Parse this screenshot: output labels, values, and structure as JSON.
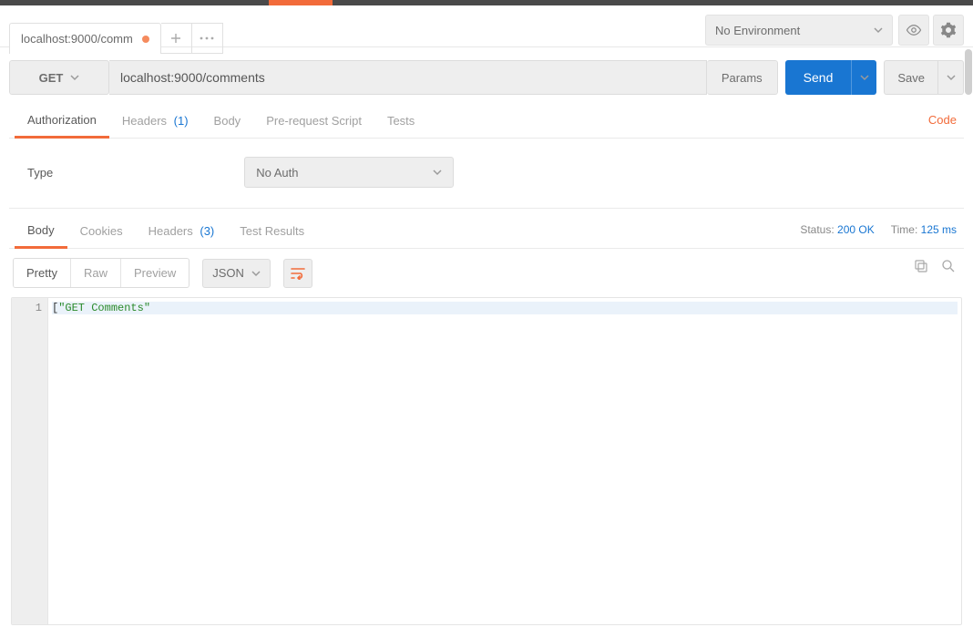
{
  "env": {
    "label": "No Environment"
  },
  "tab": {
    "title": "localhost:9000/comm",
    "unsaved": true
  },
  "request": {
    "method": "GET",
    "url": "localhost:9000/comments",
    "params_label": "Params",
    "send_label": "Send",
    "save_label": "Save"
  },
  "req_tabs": {
    "authorization": "Authorization",
    "headers_label": "Headers",
    "headers_count": "(1)",
    "body": "Body",
    "prerequest": "Pre-request Script",
    "tests": "Tests",
    "code_link": "Code"
  },
  "auth": {
    "type_label": "Type",
    "selected": "No Auth"
  },
  "resp_tabs": {
    "body": "Body",
    "cookies": "Cookies",
    "headers_label": "Headers",
    "headers_count": "(3)",
    "tests": "Test Results"
  },
  "resp_meta": {
    "status_label": "Status:",
    "status_value": "200 OK",
    "time_label": "Time:",
    "time_value": "125 ms"
  },
  "format": {
    "pretty": "Pretty",
    "raw": "Raw",
    "preview": "Preview",
    "lang": "JSON"
  },
  "response_body": {
    "line_no": "1",
    "bracket": "[",
    "content": "\"GET Comments\""
  }
}
